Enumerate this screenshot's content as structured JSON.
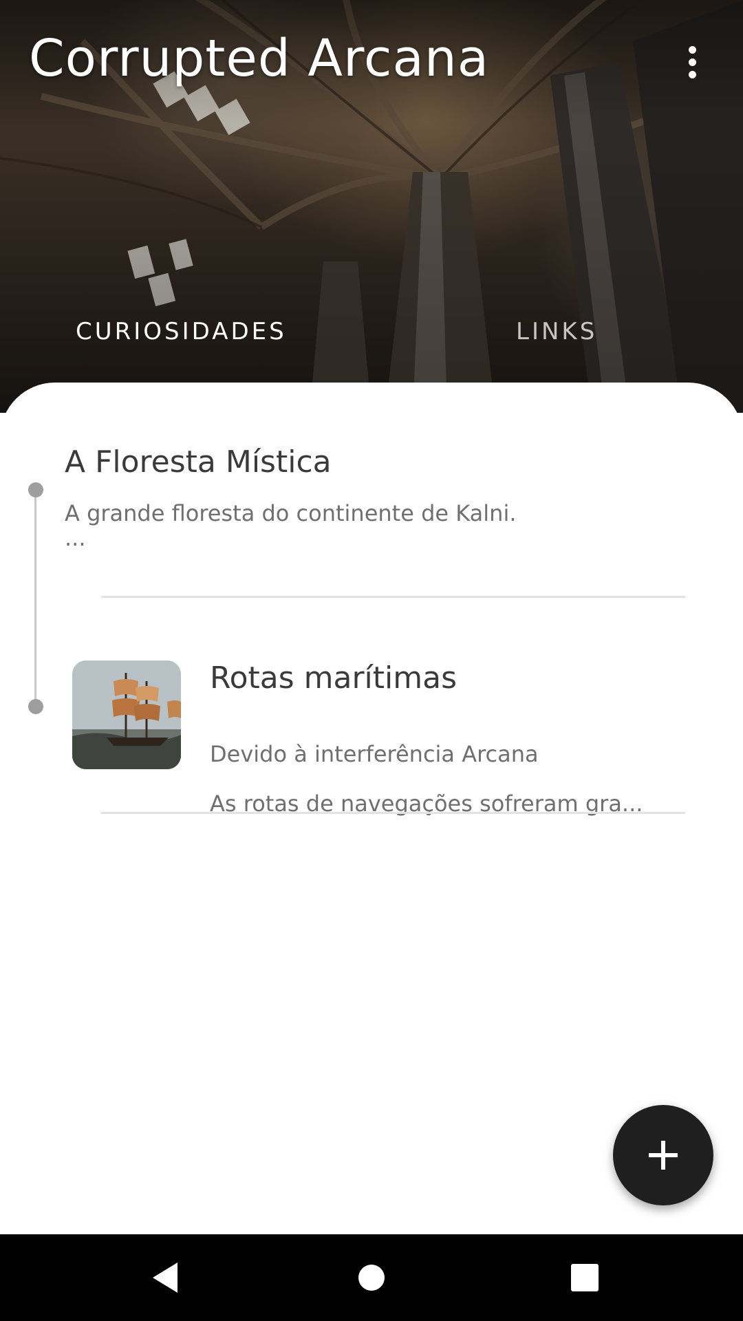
{
  "app": {
    "title": "Corrupted Arcana",
    "menu_icon": "more-vert-icon"
  },
  "tabs": [
    {
      "label": "CURIOSIDADES",
      "active": true
    },
    {
      "label": "LINKS",
      "active": false
    }
  ],
  "items": [
    {
      "title": "A Floresta Mística",
      "description": "A grande floresta do continente de Kalni.\n...",
      "has_image": false
    },
    {
      "title": "Rotas marítimas",
      "description_line1": "Devido à interferência Arcana",
      "description_line2": "As rotas de navegações sofreram gra...",
      "has_image": true,
      "image_icon": "sailing-ship-image"
    }
  ],
  "fab": {
    "icon": "plus-icon"
  },
  "navigation": {
    "back_icon": "back-triangle-icon",
    "home_icon": "home-circle-icon",
    "recent_icon": "recents-square-icon"
  },
  "colors": {
    "fab": "#1f1f1f",
    "timeline": "#9e9e9e",
    "title_text": "#3a3a3a",
    "desc_text": "#6f6f6f"
  }
}
